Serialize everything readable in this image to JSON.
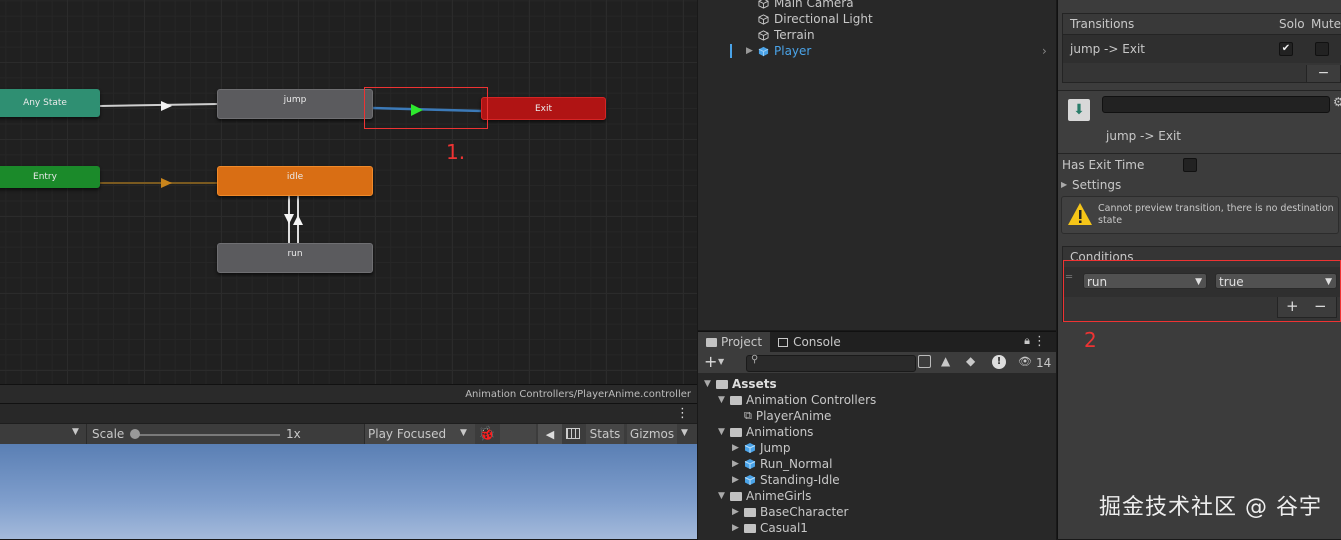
{
  "animator": {
    "nodes": {
      "any_state": "Any State",
      "entry": "Entry",
      "jump": "jump",
      "idle": "idle",
      "run": "run",
      "exit": "Exit"
    },
    "annotation_1": "1.",
    "controller_path": "Animation Controllers/PlayerAnime.controller"
  },
  "game_toolbar": {
    "scale_label": "Scale",
    "scale_value": "1x",
    "play_mode": "Play Focused",
    "stats_label": "Stats",
    "gizmos_label": "Gizmos"
  },
  "hierarchy": {
    "items": [
      {
        "label": "Main Camera",
        "selected": false
      },
      {
        "label": "Directional Light",
        "selected": false
      },
      {
        "label": "Terrain",
        "selected": false
      },
      {
        "label": "Player",
        "selected": true
      }
    ]
  },
  "project": {
    "tabs": [
      "Project",
      "Console"
    ],
    "hidden_count": "14",
    "tree": [
      {
        "label": "Assets",
        "depth": 0,
        "type": "folder",
        "expanded": true,
        "bold": true
      },
      {
        "label": "Animation Controllers",
        "depth": 1,
        "type": "folder",
        "expanded": true
      },
      {
        "label": "PlayerAnime",
        "depth": 2,
        "type": "controller"
      },
      {
        "label": "Animations",
        "depth": 1,
        "type": "folder",
        "expanded": true
      },
      {
        "label": "Jump",
        "depth": 2,
        "type": "model"
      },
      {
        "label": "Run_Normal",
        "depth": 2,
        "type": "model"
      },
      {
        "label": "Standing-Idle",
        "depth": 2,
        "type": "model"
      },
      {
        "label": "AnimeGirls",
        "depth": 1,
        "type": "folder",
        "expanded": true
      },
      {
        "label": "BaseCharacter",
        "depth": 2,
        "type": "folder"
      },
      {
        "label": "Casual1",
        "depth": 2,
        "type": "folder"
      }
    ]
  },
  "inspector": {
    "transitions_header": "Transitions",
    "solo_label": "Solo",
    "mute_label": "Mute",
    "transition_name": "jump -> Exit",
    "transition_title": "jump -> Exit",
    "has_exit_time_label": "Has Exit Time",
    "settings_label": "Settings",
    "warning_text": "Cannot preview transition, there is no destination state",
    "conditions_header": "Conditions",
    "condition_param": "run",
    "condition_value": "true",
    "annotation_2": "2"
  },
  "watermark": "掘金技术社区 @ 谷宇",
  "colors": {
    "annotation_red": "#e33333",
    "player_blue": "#4aa3e8",
    "idle_orange": "#d96e14",
    "exit_red": "#b01414",
    "entry_green": "#1b8a2a",
    "anystate_teal": "#2f8f72"
  }
}
